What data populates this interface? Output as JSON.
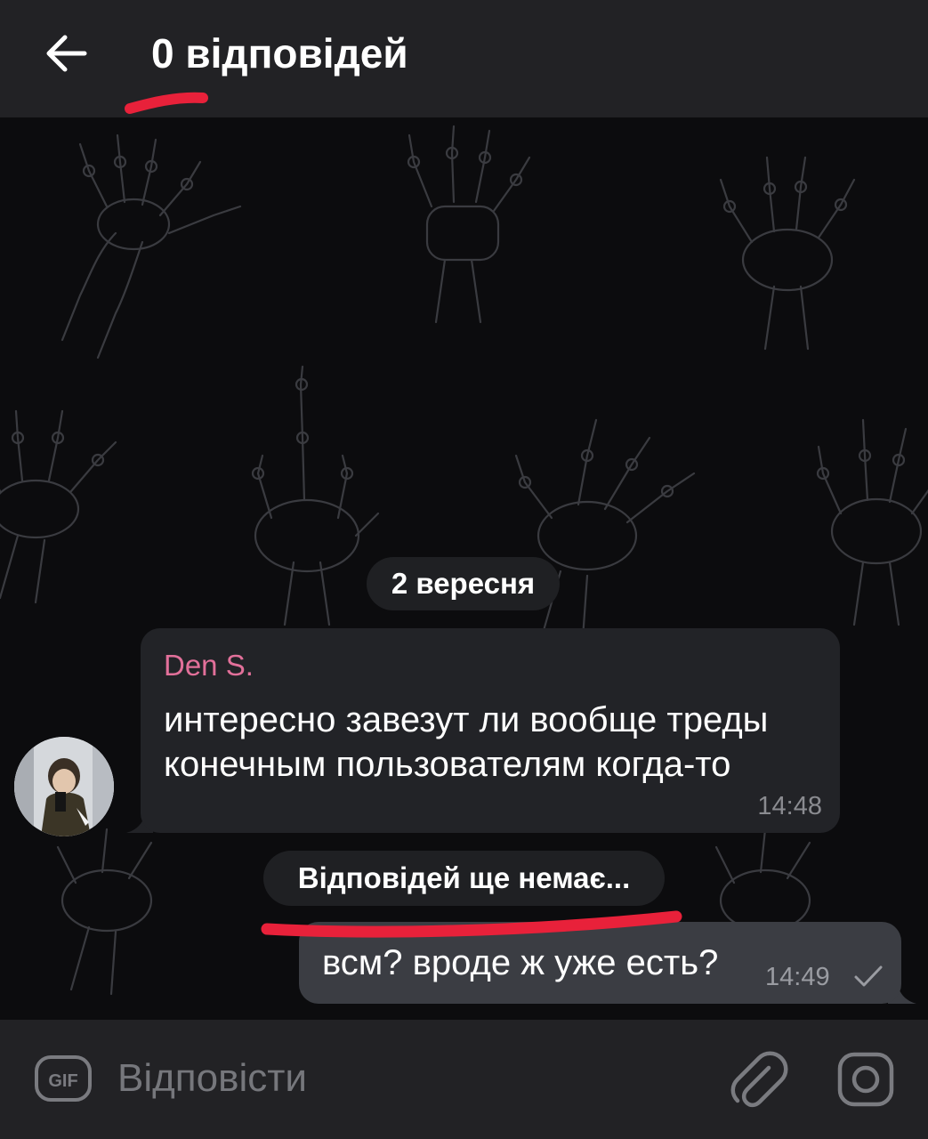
{
  "header": {
    "title": "0 відповідей",
    "back_icon": "arrow-left-icon"
  },
  "chat": {
    "date_label": "2 вересня",
    "incoming": {
      "sender": "Den S.",
      "text": "интересно завезут ли вообще треды конечным пользователям когда-то",
      "time": "14:48",
      "sender_color": "#e2709a"
    },
    "replies_status": "Відповідей ще немає...",
    "outgoing": {
      "text": "всм? вроде ж уже есть?",
      "time": "14:49",
      "status_icon": "check-icon"
    }
  },
  "composer": {
    "placeholder": "Відповісти",
    "gif_label": "GIF",
    "icons": [
      "gif-icon",
      "paperclip-icon",
      "camera-icon"
    ]
  },
  "colors": {
    "header_bg": "#222225",
    "annotation_red": "#e8213a",
    "incoming_bubble": "#222327",
    "outgoing_bubble": "#3b3d43"
  }
}
